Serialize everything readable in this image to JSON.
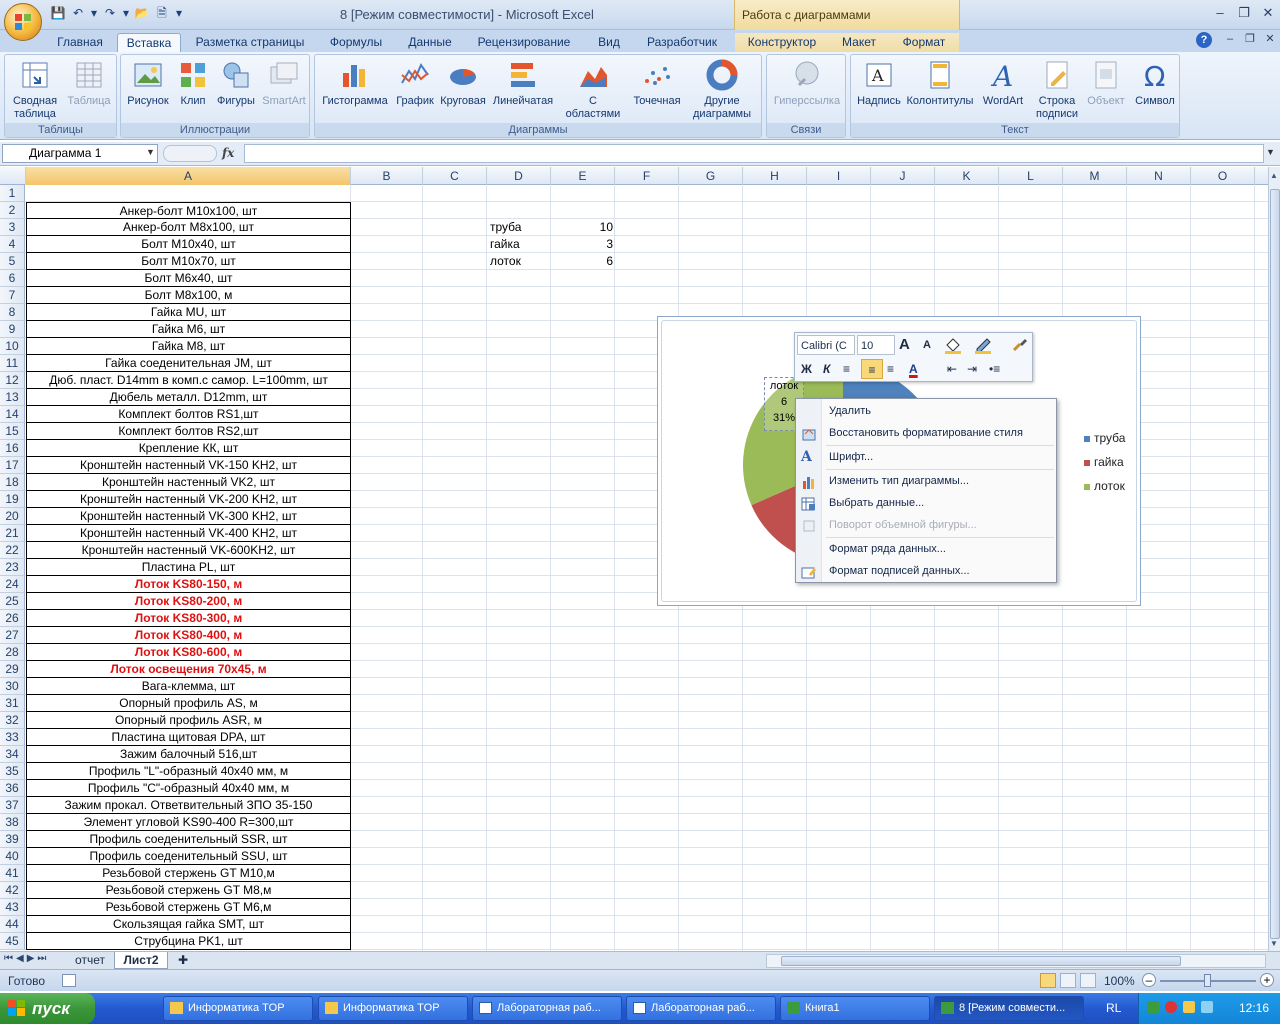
{
  "window": {
    "title": "8  [Режим совместимости] - Microsoft Excel",
    "context_title": "Работа с диаграммами"
  },
  "tabs": [
    "Главная",
    "Вставка",
    "Разметка страницы",
    "Формулы",
    "Данные",
    "Рецензирование",
    "Вид",
    "Разработчик",
    "Конструктор",
    "Макет",
    "Формат"
  ],
  "active_tab": "Вставка",
  "ribbon": {
    "groups": {
      "tables": "Таблицы",
      "illustrations": "Иллюстрации",
      "charts": "Диаграммы",
      "links": "Связи",
      "text": "Текст"
    },
    "buttons": {
      "pivot_l1": "Сводная",
      "pivot_l2": "таблица",
      "table": "Таблица",
      "picture": "Рисунок",
      "clip": "Клип",
      "shapes": "Фигуры",
      "smartart": "SmartArt",
      "histogram": "Гистограмма",
      "graph": "График",
      "pie": "Круговая",
      "bar": "Линейчатая",
      "area_l1": "С",
      "area_l2": "областями",
      "scatter": "Точечная",
      "other_l1": "Другие",
      "other_l2": "диаграммы",
      "hyperlink": "Гиперссылка",
      "textbox": "Надпись",
      "header": "Колонтитулы",
      "wordart": "WordArt",
      "sigline_l1": "Строка",
      "sigline_l2": "подписи",
      "object": "Объект",
      "symbol": "Символ"
    }
  },
  "formula_bar": {
    "name_box": "Диаграмма 1",
    "fx": "fx",
    "formula": ""
  },
  "columns": [
    "A",
    "B",
    "C",
    "D",
    "E",
    "F",
    "G",
    "H",
    "I",
    "J",
    "K",
    "L",
    "M",
    "N",
    "O"
  ],
  "rows": [
    "1",
    "2",
    "3",
    "4",
    "5",
    "6",
    "7",
    "8",
    "9",
    "10",
    "11",
    "12",
    "13",
    "14",
    "15",
    "16",
    "17",
    "18",
    "19",
    "20",
    "21",
    "22",
    "23",
    "24",
    "25",
    "26",
    "27",
    "28",
    "29",
    "30",
    "31",
    "32",
    "33",
    "34",
    "35",
    "36",
    "37",
    "38",
    "39",
    "40",
    "41",
    "42",
    "43",
    "44",
    "45"
  ],
  "column_a": [
    "",
    "Анкер-болт М10х100, шт",
    "Анкер-болт М8х100, шт",
    "Болт М10х40, шт",
    "Болт М10х70, шт",
    "Болт М6х40, шт",
    "Болт М8х100, м",
    "Гайка MU, шт",
    "Гайка М6, шт",
    "Гайка М8, шт",
    "Гайка соеденительная JM, шт",
    "Дюб.  пласт. D14mm в комп.с самор. L=100mm, шт",
    "Дюбель металл. D12mm, шт",
    "Комплект болтов RS1,шт",
    "Комплект болтов RS2,шт",
    "Крепление КК, шт",
    "Кронштейн настенный VK-150 KH2, шт",
    "Кронштейн настенный VK2, шт",
    "Кронштейн настенный VK-200 KH2, шт",
    "Кронштейн настенный VK-300 KH2, шт",
    "Кронштейн настенный VK-400 KH2, шт",
    "Кронштейн настенный VK-600KH2, шт",
    "Пластина PL, шт",
    "Лоток KS80-150, м",
    "Лоток KS80-200, м",
    "Лоток KS80-300, м",
    "Лоток KS80-400, м",
    "Лоток KS80-600, м",
    "Лоток освещения 70х45, м",
    "Вага-клемма, шт",
    "Опорный профиль AS, м",
    "Опорный профиль ASR, м",
    "Пластина щитовая DPA, шт",
    "Зажим балочный 516,шт",
    "Профиль \"L\"-образный 40х40 мм, м",
    "Профиль \"C\"-образный 40х40 мм, м",
    "Зажим прокал. Ответвительный ЗПО 35-150",
    "Элемент угловой KS90-400 R=300,шт",
    "Профиль соеденительный SSR, шт",
    "Профиль соеденительный SSU, шт",
    "Резьбовой стержень GT M10,м",
    "Резьбовой стержень GT M8,м",
    "Резьбовой стержень GT M6,м",
    "Скользящая гайка SMT, шт",
    "Струбцина PK1, шт"
  ],
  "red_rows": [
    24,
    25,
    26,
    27,
    28,
    29
  ],
  "data_table": [
    {
      "label": "труба",
      "value": "10"
    },
    {
      "label": "гайка",
      "value": "3"
    },
    {
      "label": "лоток",
      "value": "6"
    }
  ],
  "chart_data": {
    "type": "pie",
    "categories": [
      "труба",
      "гайка",
      "лоток"
    ],
    "values": [
      10,
      3,
      6
    ],
    "colors": [
      "#4f81bd",
      "#c0504d",
      "#9bbb59"
    ],
    "legend": "right",
    "data_label": {
      "category": "лоток",
      "value": "6",
      "percent": "31%"
    }
  },
  "mini_toolbar": {
    "font": "Calibri (С",
    "size": "10",
    "bold": "Ж",
    "italic": "К",
    "grow": "A",
    "shrink": "A"
  },
  "context_menu": {
    "items": [
      "Удалить",
      "Восстановить форматирование стиля",
      "Шрифт...",
      "Изменить тип диаграммы...",
      "Выбрать данные...",
      "Поворот объемной фигуры...",
      "Формат ряда данных...",
      "Формат подписей данных..."
    ]
  },
  "sheets": [
    "отчет",
    "Лист2"
  ],
  "active_sheet": "Лист2",
  "status": {
    "ready": "Готово",
    "zoom": "100%"
  },
  "taskbar": {
    "start": "пуск",
    "tasks": [
      "Информатика TOP",
      "Информатика TOP",
      "Лабораторная раб...",
      "Лабораторная раб...",
      "Книга1",
      "8  [Режим совмести..."
    ],
    "lang": "RL",
    "clock": "12:16"
  }
}
